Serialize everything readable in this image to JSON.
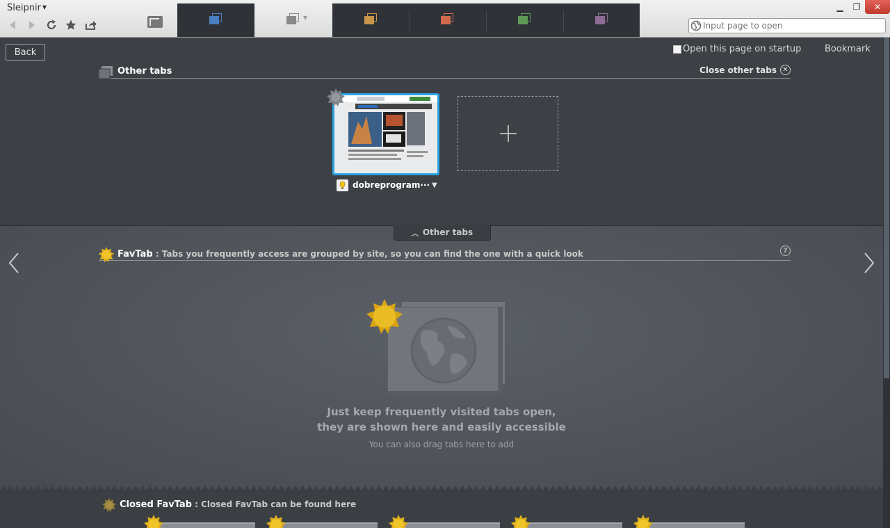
{
  "app": {
    "title": "Sleipnir"
  },
  "toolbar": {
    "back_icon": "back-arrow-icon",
    "forward_icon": "forward-arrow-icon",
    "reload_icon": "reload-icon",
    "star_icon": "star-icon",
    "share_icon": "share-icon"
  },
  "tab_groups": [
    {
      "name": "main",
      "color": "#4a7fc1"
    },
    {
      "name": "light",
      "color": "#8a8a8a"
    },
    {
      "name": "gold",
      "color": "#c9954a"
    },
    {
      "name": "orange",
      "color": "#cf6a4d"
    },
    {
      "name": "green",
      "color": "#5f9a57"
    },
    {
      "name": "purple",
      "color": "#8e6b94"
    }
  ],
  "url_bar": {
    "placeholder": "Input page to open"
  },
  "page": {
    "back_label": "Back",
    "startup_label": "Open this page on startup",
    "startup_checked": false,
    "bookmark_label": "Bookmark"
  },
  "other_tabs": {
    "title": "Other tabs",
    "close_label": "Close other tabs",
    "tabs": [
      {
        "title": "dobreprogram···"
      }
    ],
    "collapse_label": "Other tabs"
  },
  "favtab": {
    "title": "FavTab",
    "description": " : Tabs you frequently access are grouped by site, so you can find the one with a quick look",
    "help_label": "?",
    "empty_line1": "Just keep frequently visited tabs open,",
    "empty_line2": "they are shown here and easily accessible",
    "empty_line3": "You can also drag tabs here to add"
  },
  "closed_favtab": {
    "title": "Closed FavTab",
    "description": " : Closed FavTab can be found here"
  },
  "colors": {
    "accent": "#2aa5e4",
    "badge": "#e8b61c"
  }
}
